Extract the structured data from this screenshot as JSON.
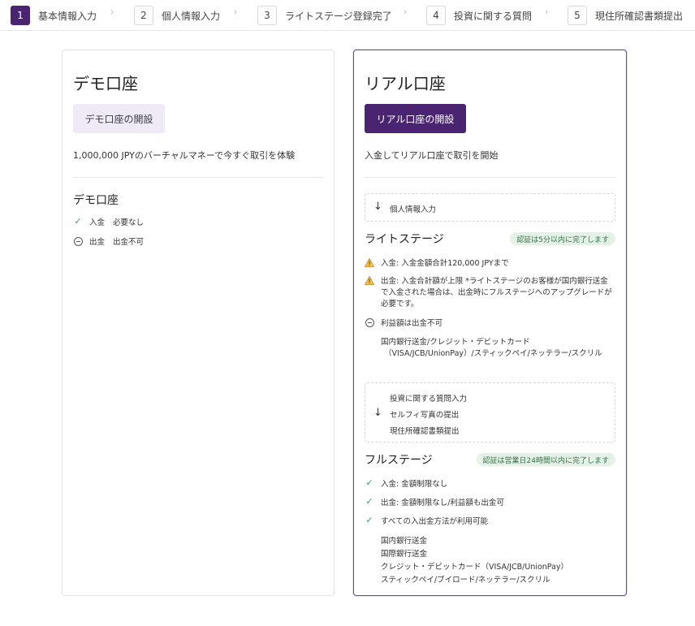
{
  "stepper": {
    "steps": [
      {
        "num": "1",
        "label": "基本情報入力",
        "active": true
      },
      {
        "num": "2",
        "label": "個人情報入力"
      },
      {
        "num": "3",
        "label": "ライトステージ登録完了"
      },
      {
        "num": "4",
        "label": "投資に関する質問"
      },
      {
        "num": "5",
        "label": "現住所確認書類提出"
      }
    ]
  },
  "demo": {
    "title": "デモ口座",
    "button_label": "デモ口座の開設",
    "description": "1,000,000 JPYのバーチャルマネーで今すぐ取引を体験",
    "section_title": "デモ口座",
    "deposit_label": "入金",
    "deposit_value": "必要なし",
    "withdraw_label": "出金",
    "withdraw_value": "出金不可"
  },
  "real": {
    "title": "リアル口座",
    "button_label": "リアル口座の開設",
    "description": "入金してリアル口座で取引を開始",
    "step_personal": "個人情報入力",
    "light": {
      "title": "ライトステージ",
      "badge": "認証は5分以内に完了します",
      "deposit": "入金: 入金金額合計120,000 JPYまで",
      "withdraw_line1": "出金: 入金合計額が上限 *ライトステージのお客様が国内銀行送金",
      "withdraw_line2": "で入金された場合は、出金時にフルステージへのアップグレードが",
      "withdraw_line3": "必要です。",
      "profit": "利益額は出金不可",
      "methods_line1": "国内銀行送金/クレジット・デビットカード",
      "methods_line2": "（VISA/JCB/UnionPay）/スティックペイ/ネッテラー/スクリル"
    },
    "steps_box": {
      "item1": "投資に関する質問入力",
      "item2": "セルフィ写真の提出",
      "item3": "現住所確認書類提出"
    },
    "full": {
      "title": "フルステージ",
      "badge": "認証は営業日24時間以内に完了します",
      "deposit": "入金: 金額制限なし",
      "withdraw": "出金: 金額制限なし/利益額も出金可",
      "all_methods": "すべての入出金方法が利用可能",
      "method1": "国内銀行送金",
      "method2": "国際銀行送金",
      "method3": "クレジット・デビットカード（VISA/JCB/UnionPay）",
      "method4": "スティックペイ/ブイロード/ネッテラー/スクリル"
    }
  },
  "colors": {
    "accent": "#4a2470",
    "check": "#3a9d6a",
    "warning": "#e0a21b",
    "badge_bg": "#e4f1e7"
  }
}
